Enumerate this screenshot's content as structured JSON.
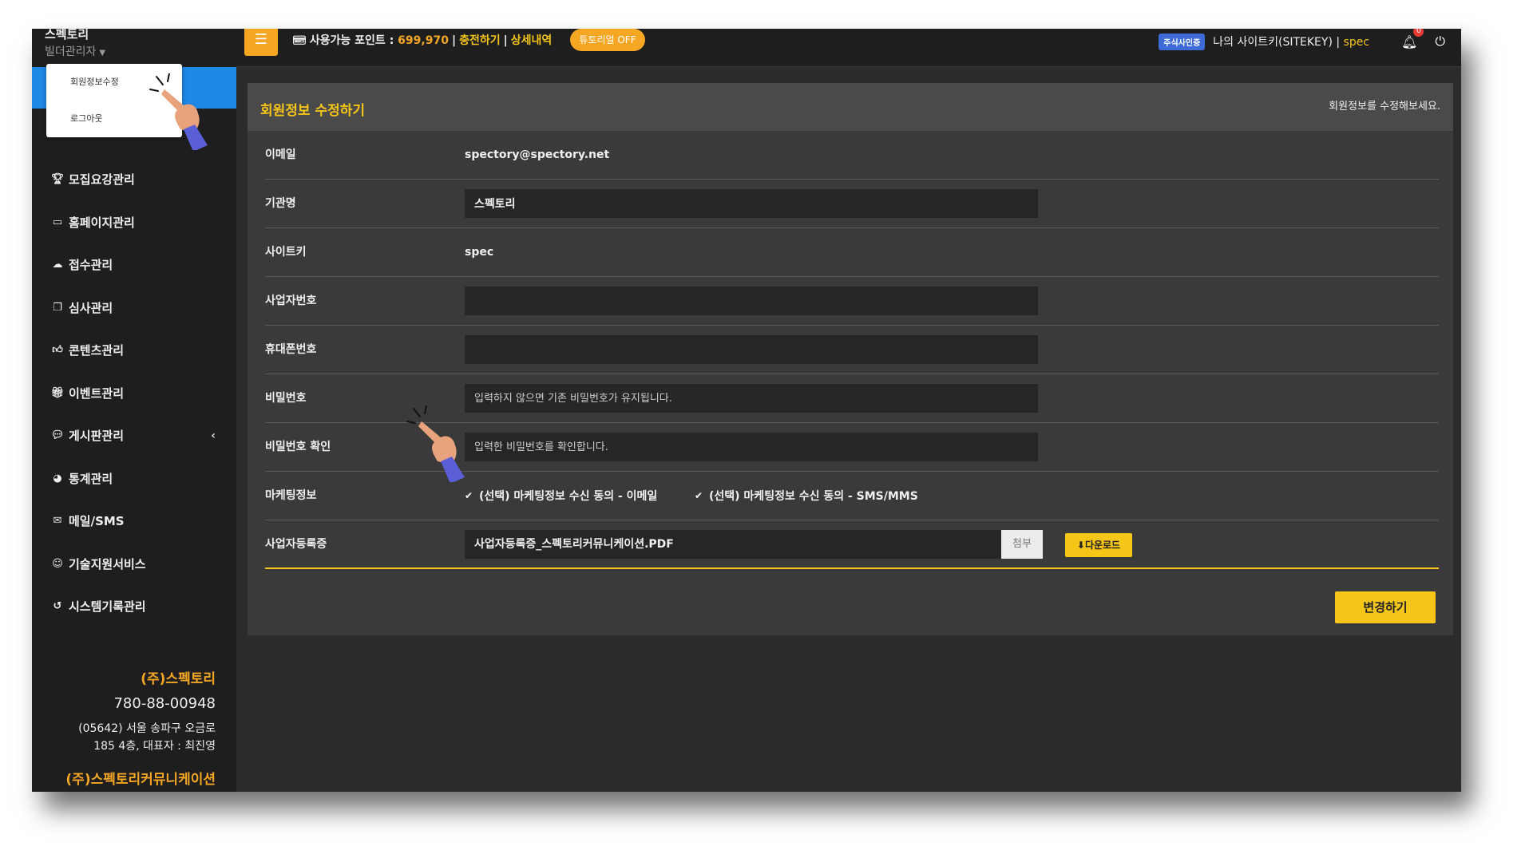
{
  "sidebar": {
    "brand": "스펙토리",
    "role": "빌더관리자",
    "dropdown": [
      {
        "label": "회원정보수정"
      },
      {
        "label": "로그아웃"
      }
    ],
    "items": [
      {
        "label": "모집요강관리",
        "icon": "trophy-icon"
      },
      {
        "label": "홈페이지관리",
        "icon": "monitor-icon"
      },
      {
        "label": "접수관리",
        "icon": "cloud-upload-icon"
      },
      {
        "label": "심사관리",
        "icon": "copy-icon"
      },
      {
        "label": "콘텐츠관리",
        "icon": "thumbs-up-icon"
      },
      {
        "label": "이벤트관리",
        "icon": "gift-icon"
      },
      {
        "label": "게시판관리",
        "icon": "comments-icon"
      },
      {
        "label": "통계관리",
        "icon": "pie-chart-icon"
      },
      {
        "label": "메일/SMS",
        "icon": "envelope-icon"
      },
      {
        "label": "기술지원서비스",
        "icon": "support-icon"
      },
      {
        "label": "시스템기록관리",
        "icon": "history-icon"
      }
    ],
    "company": {
      "name": "(주)스펙토리",
      "biz_no": "780-88-00948",
      "addr_line1": "(05642) 서울 송파구 오금로",
      "addr_line2": "185 4층, 대표자 : 최진영",
      "name2": "(주)스펙토리커뮤니케이션"
    }
  },
  "topbar": {
    "points_label": "사용가능 포인트 :",
    "points_value": "699,970",
    "charge_link": "충전하기",
    "detail_link": "상세내역",
    "tutorial_badge": "튜토리얼 OFF",
    "cert_badge": "주식사인증",
    "sitekey_label": "나의 사이트키(SITEKEY) |",
    "user_id": "spec",
    "notification_count": "0"
  },
  "panel": {
    "title": "회원정보 수정하기",
    "desc": "회원정보를 수정해보세요.",
    "email_label": "이메일",
    "email_value": "spectory@spectory.net",
    "org_label": "기관명",
    "org_value": "스펙토리",
    "sitekey_label": "사이트키",
    "sitekey_value": "spec",
    "biz_label": "사업자번호",
    "biz_value": "",
    "phone_label": "휴대폰번호",
    "phone_value": "",
    "pw_label": "비밀번호",
    "pw_placeholder": "입력하지 않으면 기존 비밀번호가 유지됩니다.",
    "pw_confirm_label": "비밀번호 확인",
    "pw_confirm_placeholder": "입력한 비밀번호를 확인합니다.",
    "marketing_label": "마케팅정보",
    "marketing_email": "(선택) 마케팅정보 수신 동의 - 이메일",
    "marketing_sms": "(선택) 마케팅정보 수신 동의 - SMS/MMS",
    "cert_label": "사업자등록증",
    "cert_file": "사업자등록증_스펙토리커뮤니케이션.PDF",
    "attach_label": "첨부",
    "download_label": "다운로드",
    "submit_label": "변경하기"
  }
}
